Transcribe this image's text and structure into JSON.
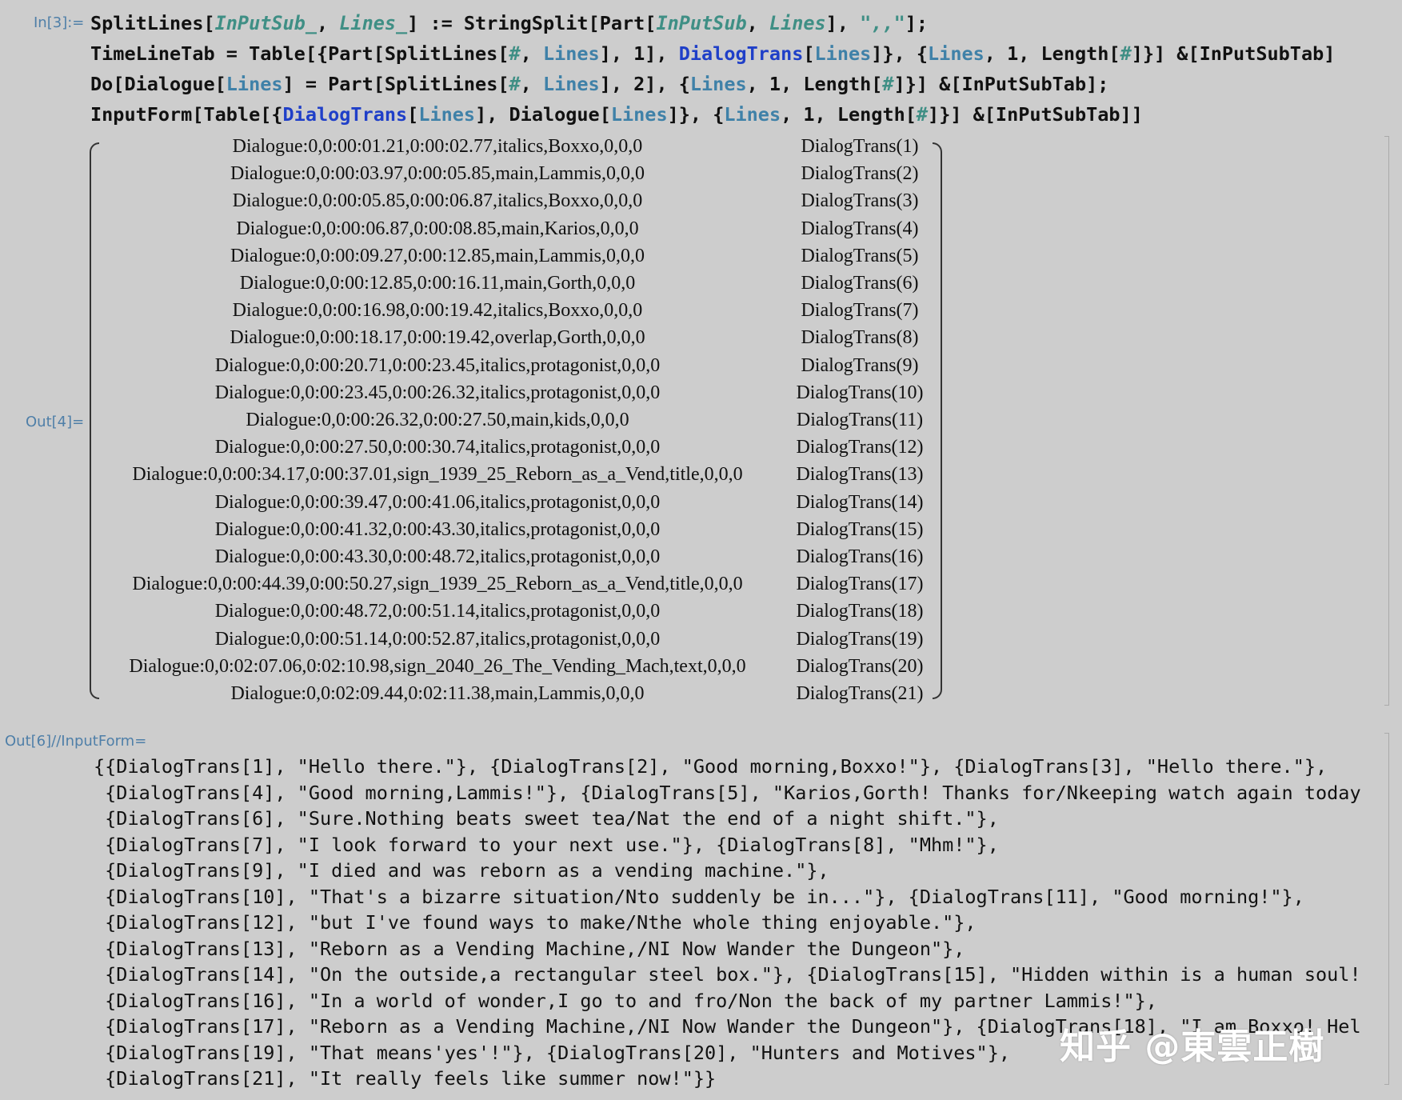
{
  "labels": {
    "in3": "In[3]:=",
    "out4": "Out[4]=",
    "out6": "Out[6]//InputForm="
  },
  "input_lines": [
    [
      [
        "SplitLines[",
        "p"
      ],
      [
        "InPutSub_",
        "v"
      ],
      [
        ", ",
        "p"
      ],
      [
        "Lines_",
        "v"
      ],
      [
        "] := StringSplit[Part[",
        "p"
      ],
      [
        "InPutSub",
        "v"
      ],
      [
        ", ",
        "p"
      ],
      [
        "Lines",
        "v"
      ],
      [
        "], ",
        "p"
      ],
      [
        "\",,\"",
        "sl"
      ],
      [
        "];",
        "p"
      ]
    ],
    [
      [
        "TimeLineTab = Table[{Part[SplitLines[",
        "p"
      ],
      [
        "#",
        "v"
      ],
      [
        ", ",
        "p"
      ],
      [
        "Lines",
        "loc"
      ],
      [
        "], 1], ",
        "p"
      ],
      [
        "DialogTrans",
        "fn"
      ],
      [
        "[",
        "p"
      ],
      [
        "Lines",
        "loc"
      ],
      [
        "]}, {",
        "p"
      ],
      [
        "Lines",
        "loc"
      ],
      [
        ", 1, Length[",
        "p"
      ],
      [
        "#",
        "v"
      ],
      [
        "]}] &[InPutSubTab]",
        "p"
      ]
    ],
    [
      [
        "Do[Dialogue[",
        "p"
      ],
      [
        "Lines",
        "loc"
      ],
      [
        "] = Part[SplitLines[",
        "p"
      ],
      [
        "#",
        "v"
      ],
      [
        ", ",
        "p"
      ],
      [
        "Lines",
        "loc"
      ],
      [
        "], 2], {",
        "p"
      ],
      [
        "Lines",
        "loc"
      ],
      [
        ", 1, Length[",
        "p"
      ],
      [
        "#",
        "v"
      ],
      [
        "]}] &[InPutSubTab];",
        "p"
      ]
    ],
    [
      [
        "InputForm[Table[{",
        "p"
      ],
      [
        "DialogTrans",
        "fn"
      ],
      [
        "[",
        "p"
      ],
      [
        "Lines",
        "loc"
      ],
      [
        "], Dialogue[",
        "p"
      ],
      [
        "Lines",
        "loc"
      ],
      [
        "]}, {",
        "p"
      ],
      [
        "Lines",
        "loc"
      ],
      [
        ", 1, Length[",
        "p"
      ],
      [
        "#",
        "v"
      ],
      [
        "]}] &[InPutSubTab]]",
        "p"
      ]
    ]
  ],
  "matrix_rows": [
    [
      "Dialogue:0,0:00:01.21,0:00:02.77,italics,Boxxo,0,0,0",
      "DialogTrans(1)"
    ],
    [
      "Dialogue:0,0:00:03.97,0:00:05.85,main,Lammis,0,0,0",
      "DialogTrans(2)"
    ],
    [
      "Dialogue:0,0:00:05.85,0:00:06.87,italics,Boxxo,0,0,0",
      "DialogTrans(3)"
    ],
    [
      "Dialogue:0,0:00:06.87,0:00:08.85,main,Karios,0,0,0",
      "DialogTrans(4)"
    ],
    [
      "Dialogue:0,0:00:09.27,0:00:12.85,main,Lammis,0,0,0",
      "DialogTrans(5)"
    ],
    [
      "Dialogue:0,0:00:12.85,0:00:16.11,main,Gorth,0,0,0",
      "DialogTrans(6)"
    ],
    [
      "Dialogue:0,0:00:16.98,0:00:19.42,italics,Boxxo,0,0,0",
      "DialogTrans(7)"
    ],
    [
      "Dialogue:0,0:00:18.17,0:00:19.42,overlap,Gorth,0,0,0",
      "DialogTrans(8)"
    ],
    [
      "Dialogue:0,0:00:20.71,0:00:23.45,italics,protagonist,0,0,0",
      "DialogTrans(9)"
    ],
    [
      "Dialogue:0,0:00:23.45,0:00:26.32,italics,protagonist,0,0,0",
      "DialogTrans(10)"
    ],
    [
      "Dialogue:0,0:00:26.32,0:00:27.50,main,kids,0,0,0",
      "DialogTrans(11)"
    ],
    [
      "Dialogue:0,0:00:27.50,0:00:30.74,italics,protagonist,0,0,0",
      "DialogTrans(12)"
    ],
    [
      "Dialogue:0,0:00:34.17,0:00:37.01,sign_1939_25_Reborn_as_a_Vend,title,0,0,0",
      "DialogTrans(13)"
    ],
    [
      "Dialogue:0,0:00:39.47,0:00:41.06,italics,protagonist,0,0,0",
      "DialogTrans(14)"
    ],
    [
      "Dialogue:0,0:00:41.32,0:00:43.30,italics,protagonist,0,0,0",
      "DialogTrans(15)"
    ],
    [
      "Dialogue:0,0:00:43.30,0:00:48.72,italics,protagonist,0,0,0",
      "DialogTrans(16)"
    ],
    [
      "Dialogue:0,0:00:44.39,0:00:50.27,sign_1939_25_Reborn_as_a_Vend,title,0,0,0",
      "DialogTrans(17)"
    ],
    [
      "Dialogue:0,0:00:48.72,0:00:51.14,italics,protagonist,0,0,0",
      "DialogTrans(18)"
    ],
    [
      "Dialogue:0,0:00:51.14,0:00:52.87,italics,protagonist,0,0,0",
      "DialogTrans(19)"
    ],
    [
      "Dialogue:0,0:02:07.06,0:02:10.98,sign_2040_26_The_Vending_Mach,text,0,0,0",
      "DialogTrans(20)"
    ],
    [
      "Dialogue:0,0:02:09.44,0:02:11.38,main,Lammis,0,0,0",
      "DialogTrans(21)"
    ]
  ],
  "output_lines": [
    "{{DialogTrans[1], \"Hello there.\"}, {DialogTrans[2], \"Good morning,Boxxo!\"}, {DialogTrans[3], \"Hello there.\"},",
    " {DialogTrans[4], \"Good morning,Lammis!\"}, {DialogTrans[5], \"Karios,Gorth! Thanks for/Nkeeping watch again today",
    " {DialogTrans[6], \"Sure.Nothing beats sweet tea/Nat the end of a night shift.\"},",
    " {DialogTrans[7], \"I look forward to your next use.\"}, {DialogTrans[8], \"Mhm!\"},",
    " {DialogTrans[9], \"I died and was reborn as a vending machine.\"},",
    " {DialogTrans[10], \"That's a bizarre situation/Nto suddenly be in...\"}, {DialogTrans[11], \"Good morning!\"},",
    " {DialogTrans[12], \"but I've found ways to make/Nthe whole thing enjoyable.\"},",
    " {DialogTrans[13], \"Reborn as a Vending Machine,/NI Now Wander the Dungeon\"},",
    " {DialogTrans[14], \"On the outside,a rectangular steel box.\"}, {DialogTrans[15], \"Hidden within is a human soul!",
    " {DialogTrans[16], \"In a world of wonder,I go to and fro/Non the back of my partner Lammis!\"},",
    " {DialogTrans[17], \"Reborn as a Vending Machine,/NI Now Wander the Dungeon\"}, {DialogTrans[18], \"I am Boxxo! Hel",
    " {DialogTrans[19], \"That means'yes'!\"}, {DialogTrans[20], \"Hunters and Motives\"},",
    " {DialogTrans[21], \"It really feels like summer now!\"}}"
  ],
  "watermark": "知乎 @東雲正樹"
}
